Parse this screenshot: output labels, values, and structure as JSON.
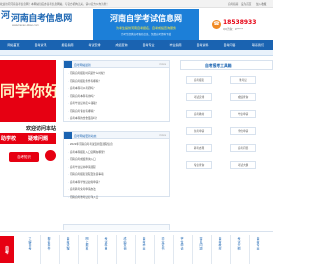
{
  "topbar": {
    "notice": "欢迎访问河南自考信息网！本网站为民办自考信息网站，与官方机构无关，请以官方公布为准！",
    "links": [
      "自考指南",
      "设为首页",
      "加入收藏"
    ]
  },
  "logo": {
    "mark": "河",
    "name": "河南自考信息网",
    "url": "www.henan-zikao.com"
  },
  "banner": {
    "title": "河南自学考试信息网",
    "subtitle": "为考生提供河南自考报名、自考成绩查询服务",
    "tagline": "为考生提供自考报名信息、免费自考资料下载"
  },
  "contact": {
    "phone_icon": "phone-icon",
    "phone": "18538933",
    "qq": "QQ咨询：9*****"
  },
  "nav": {
    "items": [
      "网站首页",
      "自考资讯",
      "报名指南",
      "考试安排",
      "成绩查询",
      "自考专业",
      "毕业指南",
      "自考资料",
      "自考问答",
      "联系我们"
    ]
  },
  "hero": {
    "text": "同学你好"
  },
  "welcome": {
    "title": "欢迎访问本站",
    "left_badge": "助学校",
    "right_badge": "疑难问题"
  },
  "knowledge_button": "自考知识",
  "panel1": {
    "title": "自考网站最新",
    "more": "more",
    "items": [
      "河南自考报名时间是什么时候？",
      "河南自考报名条件有哪些？",
      "自考本科可以考研吗？",
      "河南自考本科有用吗？",
      "自考毕业证书怎么领取？",
      "河南自考专业有哪些？",
      "自考本科的含金量高吗？",
      "河南自学考试难度大吗？"
    ]
  },
  "panel2": {
    "title": "自考网站更新动态",
    "more": "more",
    "items": [
      "2022年河南自考考试安排及课程信息",
      "自考本科报名入口官网在哪里？",
      "河南自考成绩查询入口",
      "自考毕业证书申请流程",
      "河南自考报名流程及注意事项",
      "自考本科学位证如何申请？",
      "自考转考免考申请办法",
      "河南自考准考证打印入口"
    ]
  },
  "right": {
    "title": "自考报考工具箱",
    "tools": [
      "自考报名",
      "准考证",
      "考试安排",
      "成绩查询",
      "自考教材",
      "毕业申请",
      "免考申请",
      "学位申请",
      "转考办理",
      "自考问答",
      "专业查询",
      "考试大纲"
    ]
  },
  "bottom": {
    "label": "自考",
    "items": [
      "了解自考",
      "报名条件",
      "自考流程",
      "网上报名",
      "考试科目",
      "成绩查询",
      "自考毕业",
      "毕业证书",
      "学位申请",
      "常见问题",
      "自考教材",
      "考试大纲",
      "自考专业",
      "联系我们"
    ]
  }
}
